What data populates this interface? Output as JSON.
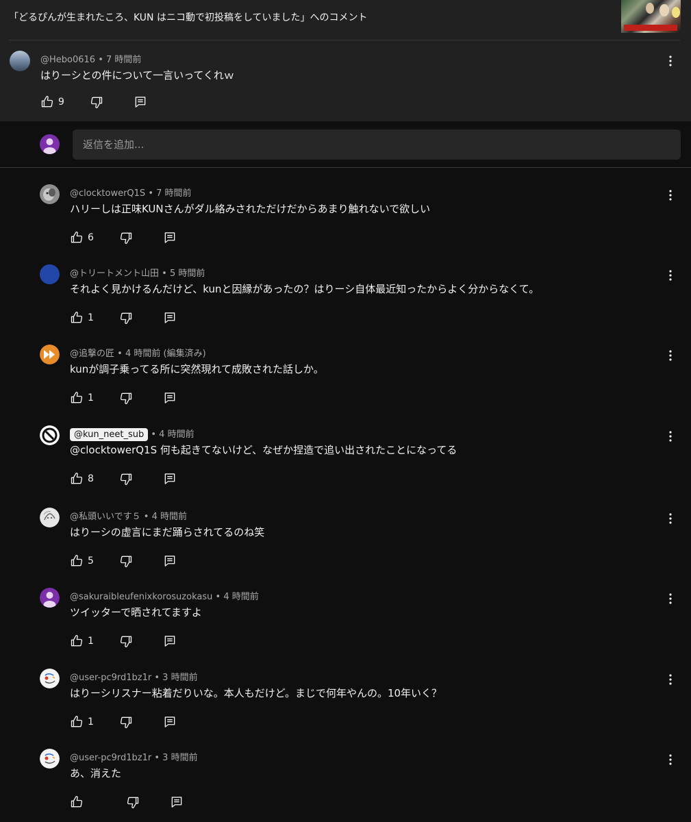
{
  "header": {
    "title": "「どるぴんが生まれたころ、KUN はニコ動で初投稿をしていました」へのコメント"
  },
  "parent_comment": {
    "handle": "@Hebo0616",
    "time": "7 時間前",
    "text": "はりーシとの件について一言いってくれｗ",
    "likes": "9"
  },
  "reply_box": {
    "placeholder": "返信を追加..."
  },
  "replies": [
    {
      "handle": "@clocktowerQ1S",
      "time": "7 時間前",
      "text": "ハリーしは正味KUNさんがダル絡みされただけだからあまり触れないで欲しい",
      "likes": "6"
    },
    {
      "handle": "@トリートメント山田",
      "time": "5 時間前",
      "text": "それよく見かけるんだけど、kunと因縁があったの？はりーシ自体最近知ったからよく分からなくて。",
      "likes": "1"
    },
    {
      "handle": "@追撃の匠",
      "time": "4 時間前 (編集済み)",
      "text": "kunが調子乗ってる所に突然現れて成敗された話しか。",
      "likes": "1"
    },
    {
      "handle": "@kun_neet_sub",
      "time": "4 時間前",
      "text": "@clocktowerQ1S 何も起きてないけど、なぜか捏造で追い出されたことになってる",
      "likes": "8"
    },
    {
      "handle": "@私頭いいです５",
      "time": "4 時間前",
      "text": "はりーシの虚言にまだ踊らされてるのね笑",
      "likes": "5"
    },
    {
      "handle": "@sakuraibleufenixkorosuzokasu",
      "time": "4 時間前",
      "text": "ツイッターで晒されてますよ",
      "likes": "1"
    },
    {
      "handle": "@user-pc9rd1bz1r",
      "time": "3 時間前",
      "text": "はりーシリスナー粘着だりいな。本人もだけど。まじで何年やんの。10年いく？",
      "likes": "1"
    },
    {
      "handle": "@user-pc9rd1bz1r",
      "time": "3 時間前",
      "text": "あ、消えた",
      "likes": ""
    }
  ],
  "separator": "•",
  "colors": {
    "background": "#0f0f0f",
    "parent_background": "#212121",
    "input_background": "#272727",
    "meta_text": "#aaaaaa",
    "text": "#f1f1f1"
  },
  "icons": {
    "like": "thumbs-up-icon",
    "dislike": "thumbs-down-icon",
    "reply": "comment-icon",
    "more": "more-vertical-icon"
  }
}
